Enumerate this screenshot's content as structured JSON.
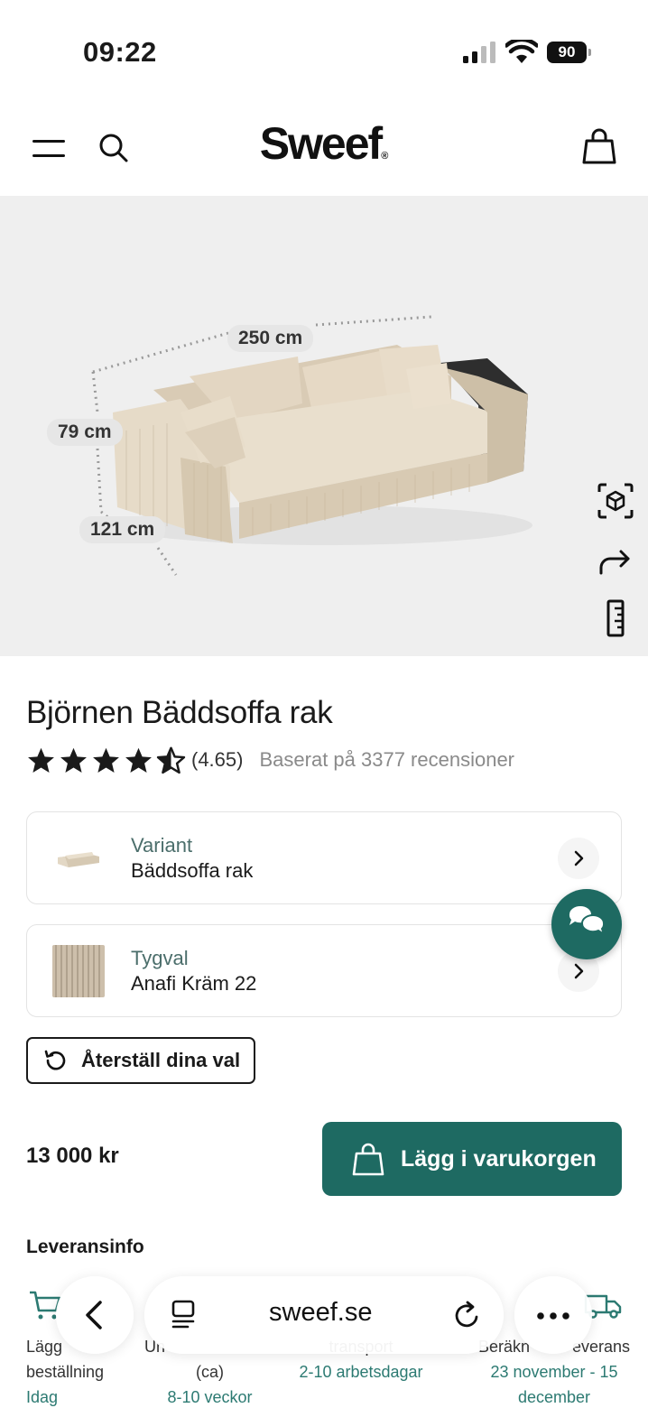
{
  "status_bar": {
    "time": "09:22",
    "battery": "90"
  },
  "header": {
    "logo": "Sweef",
    "logo_mark": "®"
  },
  "hero": {
    "dimensions": {
      "width": "250 cm",
      "height": "79 cm",
      "depth": "121 cm"
    },
    "tools": [
      "ar-view-icon",
      "share-icon",
      "ruler-icon"
    ]
  },
  "product": {
    "title": "Björnen Bäddsoffa rak",
    "rating": 4.65,
    "rating_text": "(4.65)",
    "reviews_text": "Baserat på 3377 recensioner"
  },
  "options": [
    {
      "label": "Variant",
      "value": "Bäddsoffa rak"
    },
    {
      "label": "Tygval",
      "value": "Anafi Kräm 22"
    }
  ],
  "reset_label": "Återställ dina val",
  "price": "13 000 kr",
  "add_to_cart_label": "Lägg i varukorgen",
  "delivery": {
    "heading": "Leveransinfo",
    "steps": [
      {
        "line1": "Lägg",
        "line2": "beställning",
        "line3": "Idag"
      },
      {
        "line1": "Un",
        "line2": "(ca)",
        "line3": "8-10 veckor"
      },
      {
        "line1": "",
        "line2": "transport",
        "line3": "2-10 arbetsdagar"
      },
      {
        "line1": "Beräkn",
        "line1b": "everans",
        "line2": "23 november - 15",
        "line3": "december"
      }
    ]
  },
  "browser": {
    "url": "sweef.se"
  },
  "colors": {
    "accent": "#1e6a62",
    "label": "#4b6e6b",
    "muted": "#8a8a8a",
    "hero_bg": "#efefef"
  }
}
